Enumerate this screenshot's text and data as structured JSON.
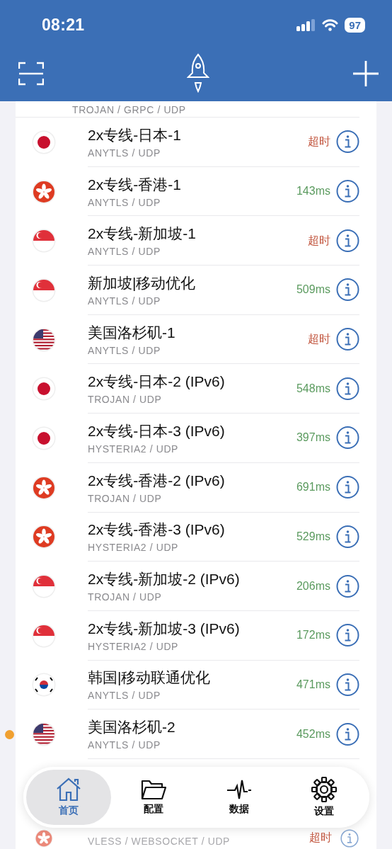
{
  "status_bar": {
    "time": "08:21",
    "battery": "97"
  },
  "nodes": [
    {
      "kind": "cut_top",
      "protocol": "TROJAN / GRPC / UDP"
    },
    {
      "kind": "jp",
      "name": "2x专线-日本-1",
      "protocol": "ANYTLS / UDP",
      "latency": "超时",
      "color": "#c2563f",
      "selected": false
    },
    {
      "kind": "hk",
      "name": "2x专线-香港-1",
      "protocol": "ANYTLS / UDP",
      "latency": "143ms",
      "color": "#5a9a5e",
      "selected": false
    },
    {
      "kind": "sg",
      "name": "2x专线-新加坡-1",
      "protocol": "ANYTLS / UDP",
      "latency": "超时",
      "color": "#c2563f",
      "selected": false
    },
    {
      "kind": "sg",
      "name": "新加坡|移动优化",
      "protocol": "ANYTLS / UDP",
      "latency": "509ms",
      "color": "#5a9a5e",
      "selected": false
    },
    {
      "kind": "us",
      "name": "美国洛杉矶-1",
      "protocol": "ANYTLS / UDP",
      "latency": "超时",
      "color": "#c2563f",
      "selected": false
    },
    {
      "kind": "jp",
      "name": "2x专线-日本-2 (IPv6)",
      "protocol": "TROJAN / UDP",
      "latency": "548ms",
      "color": "#5a9a5e",
      "selected": false
    },
    {
      "kind": "jp",
      "name": "2x专线-日本-3 (IPv6)",
      "protocol": "HYSTERIA2 / UDP",
      "latency": "397ms",
      "color": "#5a9a5e",
      "selected": false
    },
    {
      "kind": "hk",
      "name": "2x专线-香港-2 (IPv6)",
      "protocol": "TROJAN / UDP",
      "latency": "691ms",
      "color": "#5a9a5e",
      "selected": false
    },
    {
      "kind": "hk",
      "name": "2x专线-香港-3 (IPv6)",
      "protocol": "HYSTERIA2 / UDP",
      "latency": "529ms",
      "color": "#5a9a5e",
      "selected": false
    },
    {
      "kind": "sg",
      "name": "2x专线-新加坡-2 (IPv6)",
      "protocol": "TROJAN / UDP",
      "latency": "206ms",
      "color": "#5a9a5e",
      "selected": false
    },
    {
      "kind": "sg",
      "name": "2x专线-新加坡-3 (IPv6)",
      "protocol": "HYSTERIA2 / UDP",
      "latency": "172ms",
      "color": "#5a9a5e",
      "selected": false
    },
    {
      "kind": "kr",
      "name": "韩国|移动联通优化",
      "protocol": "ANYTLS / UDP",
      "latency": "471ms",
      "color": "#5a9a5e",
      "selected": false
    },
    {
      "kind": "us",
      "name": "美国洛杉矶-2",
      "protocol": "ANYTLS / UDP",
      "latency": "452ms",
      "color": "#5a9a5e",
      "selected": true
    },
    {
      "kind": "hidden"
    },
    {
      "kind": "hk",
      "protocol": "VLESS / WEBSOCKET / UDP",
      "latency": "超时",
      "color": "#c2563f",
      "selected": false
    }
  ],
  "tab_bar": [
    {
      "label": "首页",
      "selected": true
    },
    {
      "label": "配置",
      "selected": false
    },
    {
      "label": "数据",
      "selected": false
    },
    {
      "label": "设置",
      "selected": false
    }
  ]
}
